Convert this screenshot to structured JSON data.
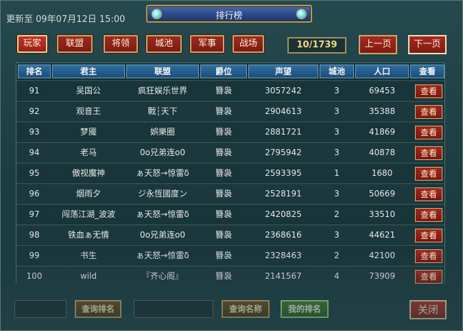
{
  "header": {
    "updated_text": "更新至 09年07月12日 15:00",
    "title": "排行榜"
  },
  "categories": [
    {
      "label": "玩家"
    },
    {
      "label": "联盟"
    },
    {
      "label": "将领"
    },
    {
      "label": "城池"
    },
    {
      "label": "军事"
    },
    {
      "label": "战场"
    }
  ],
  "pager": {
    "count": "10/1739",
    "prev_label": "上一页",
    "next_label": "下一页"
  },
  "table": {
    "columns": [
      "排名",
      "君主",
      "联盟",
      "爵位",
      "声望",
      "城池",
      "人口",
      "查看"
    ],
    "rows": [
      {
        "rank": "91",
        "lord": "吴国公",
        "alliance": "疯狂娱乐世界",
        "title": "簪袅",
        "prestige": "3057242",
        "cities": "3",
        "population": "69453",
        "view": "查看"
      },
      {
        "rank": "92",
        "lord": "观音王",
        "alliance": "戰┆天下",
        "title": "簪袅",
        "prestige": "2904613",
        "cities": "3",
        "population": "35388",
        "view": "查看"
      },
      {
        "rank": "93",
        "lord": "梦魇",
        "alliance": "娯樂圈",
        "title": "簪袅",
        "prestige": "2881721",
        "cities": "3",
        "population": "41869",
        "view": "查看"
      },
      {
        "rank": "94",
        "lord": "老马",
        "alliance": "0o兄弟连o0",
        "title": "簪袅",
        "prestige": "2795942",
        "cities": "3",
        "population": "40878",
        "view": "查看"
      },
      {
        "rank": "95",
        "lord": "傲视魔神",
        "alliance": "ぁ天怒→惊雷δ",
        "title": "簪袅",
        "prestige": "2593395",
        "cities": "1",
        "population": "1680",
        "view": "查看"
      },
      {
        "rank": "96",
        "lord": "烟雨夕",
        "alliance": "ジ永恆國度ン",
        "title": "簪袅",
        "prestige": "2528191",
        "cities": "3",
        "population": "50669",
        "view": "查看"
      },
      {
        "rank": "97",
        "lord": "闯荡江湖_波波",
        "alliance": "ぁ天怒→惊雷δ",
        "title": "簪袅",
        "prestige": "2420825",
        "cities": "2",
        "population": "33510",
        "view": "查看"
      },
      {
        "rank": "98",
        "lord": "铁血ぁ无情",
        "alliance": "0o兄弟连o0",
        "title": "簪袅",
        "prestige": "2368616",
        "cities": "3",
        "population": "44621",
        "view": "查看"
      },
      {
        "rank": "99",
        "lord": "书生",
        "alliance": "ぁ天怒→惊雷δ",
        "title": "簪袅",
        "prestige": "2328463",
        "cities": "2",
        "population": "42100",
        "view": "查看"
      },
      {
        "rank": "100",
        "lord": "wild",
        "alliance": "『齐心阁』",
        "title": "簪袅",
        "prestige": "2141567",
        "cities": "4",
        "population": "73909",
        "view": "查看"
      }
    ]
  },
  "footer": {
    "search_rank_value": "",
    "search_rank_label": "查询排名",
    "search_name_value": "",
    "search_name_label": "查询名称",
    "my_rank_label": "我的排名",
    "close_label": "关闭"
  }
}
